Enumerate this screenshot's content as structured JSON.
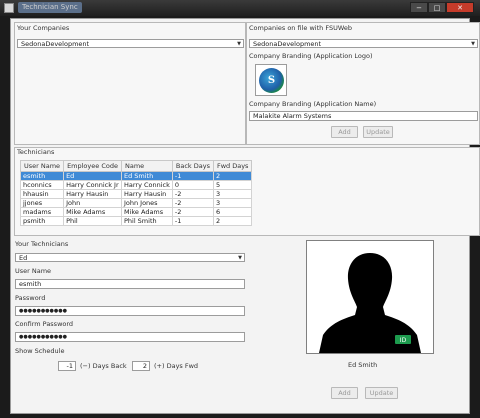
{
  "window": {
    "title": "Technician Sync",
    "min": "−",
    "max": "□",
    "close": "✕"
  },
  "your_companies": {
    "label": "Your Companies",
    "selected": "SedonaDevelopment"
  },
  "fsu": {
    "label": "Companies on file with FSUWeb",
    "selected": "SedonaDevelopment",
    "logo_label": "Company Branding (Application Logo)",
    "logo_letter": "S",
    "name_label": "Company Branding (Application Name)",
    "name_value": "Malakite Alarm Systems",
    "add": "Add",
    "update": "Update"
  },
  "technicians": {
    "label": "Technicians",
    "columns": [
      "User Name",
      "Employee Code",
      "Name",
      "Back Days",
      "Fwd Days"
    ],
    "rows": [
      [
        "esmith",
        "Ed",
        "Ed Smith",
        "-1",
        "2"
      ],
      [
        "hconnics",
        "Harry Connick Jr",
        "Harry Connick",
        "0",
        "5"
      ],
      [
        "hhausin",
        "Harry Hausin",
        "Harry Hausin",
        "-2",
        "3"
      ],
      [
        "jjones",
        "John",
        "John Jones",
        "-2",
        "3"
      ],
      [
        "madams",
        "Mike Adams",
        "Mike Adams",
        "-2",
        "6"
      ],
      [
        "psmith",
        "Phil",
        "Phil Smith",
        "-1",
        "2"
      ]
    ],
    "selected_row": 0
  },
  "your_technicians": {
    "label": "Your Technicians",
    "selected": "Ed",
    "username_label": "User Name",
    "username_value": "esmith",
    "password_label": "Password",
    "password_value": "●●●●●●●●●●●",
    "confirm_label": "Confirm Password",
    "confirm_value": "●●●●●●●●●●●",
    "schedule_label": "Show Schedule",
    "back_value": "-1",
    "back_label": "(−) Days Back",
    "fwd_value": "2",
    "fwd_label": "(+) Days Fwd"
  },
  "photo": {
    "caption": "Ed Smith",
    "badge": "ID"
  },
  "bottom": {
    "add": "Add",
    "update": "Update"
  },
  "colors": {
    "selection": "#3f8ad6",
    "close_button": "#c53b2a"
  }
}
